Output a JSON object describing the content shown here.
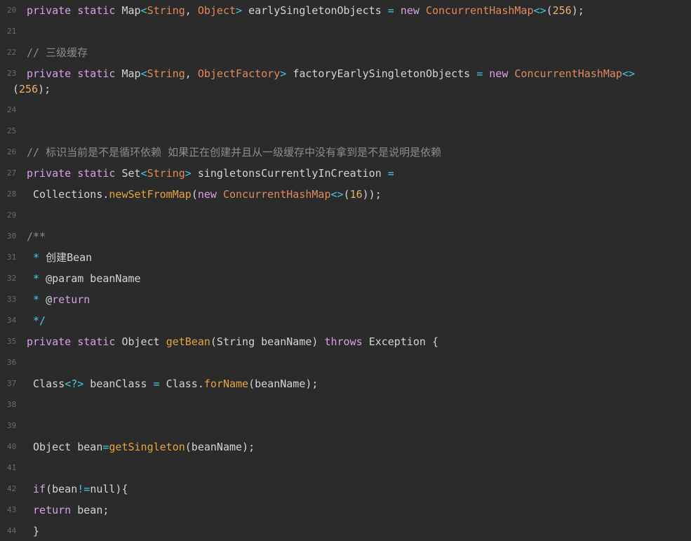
{
  "colors": {
    "background": "#2b2b2b",
    "line_number": "#6b6b6b",
    "plain": "#d4d4d4",
    "keyword": "#d7a0e6",
    "type": "#e08a5b",
    "operator": "#46c8e0",
    "function": "#e6a33e",
    "number": "#e8b26a",
    "comment": "#8c8c8c"
  },
  "lines": [
    {
      "num": "20",
      "tokens": [
        {
          "t": "private static ",
          "c": "kw"
        },
        {
          "t": "Map",
          "c": "pl"
        },
        {
          "t": "<",
          "c": "op"
        },
        {
          "t": "String",
          "c": "ty"
        },
        {
          "t": ", ",
          "c": "pl"
        },
        {
          "t": "Object",
          "c": "ty"
        },
        {
          "t": "> ",
          "c": "op"
        },
        {
          "t": "earlySingletonObjects ",
          "c": "pl"
        },
        {
          "t": "= ",
          "c": "op"
        },
        {
          "t": "new ",
          "c": "kw"
        },
        {
          "t": "ConcurrentHashMap",
          "c": "ty"
        },
        {
          "t": "<>",
          "c": "op"
        },
        {
          "t": "(",
          "c": "pl"
        },
        {
          "t": "256",
          "c": "nm"
        },
        {
          "t": ");",
          "c": "pl"
        }
      ]
    },
    {
      "num": "21",
      "tokens": []
    },
    {
      "num": "22",
      "tokens": [
        {
          "t": "// 三级缓存",
          "c": "cm"
        }
      ]
    },
    {
      "num": "23",
      "tokens": [
        {
          "t": "private static ",
          "c": "kw"
        },
        {
          "t": "Map",
          "c": "pl"
        },
        {
          "t": "<",
          "c": "op"
        },
        {
          "t": "String",
          "c": "ty"
        },
        {
          "t": ", ",
          "c": "pl"
        },
        {
          "t": "ObjectFactory",
          "c": "ty"
        },
        {
          "t": "> ",
          "c": "op"
        },
        {
          "t": "factoryEarlySingletonObjects ",
          "c": "pl"
        },
        {
          "t": "= ",
          "c": "op"
        },
        {
          "t": "new ",
          "c": "kw"
        },
        {
          "t": "ConcurrentHashMap",
          "c": "ty"
        },
        {
          "t": "<>",
          "c": "op"
        }
      ],
      "wrap": [
        {
          "t": "(",
          "c": "pl"
        },
        {
          "t": "256",
          "c": "nm"
        },
        {
          "t": ");",
          "c": "pl"
        }
      ]
    },
    {
      "num": "24",
      "tokens": []
    },
    {
      "num": "25",
      "tokens": []
    },
    {
      "num": "26",
      "tokens": [
        {
          "t": "// 标识当前是不是循环依赖 如果正在创建并且从一级缓存中没有拿到是不是说明是依赖",
          "c": "cm"
        }
      ]
    },
    {
      "num": "27",
      "tokens": [
        {
          "t": "private static ",
          "c": "kw"
        },
        {
          "t": "Set",
          "c": "pl"
        },
        {
          "t": "<",
          "c": "op"
        },
        {
          "t": "String",
          "c": "ty"
        },
        {
          "t": "> ",
          "c": "op"
        },
        {
          "t": "singletonsCurrentlyInCreation ",
          "c": "pl"
        },
        {
          "t": "=",
          "c": "op"
        }
      ]
    },
    {
      "num": "28",
      "tokens": [
        {
          "t": " Collections.",
          "c": "pl"
        },
        {
          "t": "newSetFromMap",
          "c": "fn"
        },
        {
          "t": "(",
          "c": "pl"
        },
        {
          "t": "new ",
          "c": "kw"
        },
        {
          "t": "ConcurrentHashMap",
          "c": "ty"
        },
        {
          "t": "<>",
          "c": "op"
        },
        {
          "t": "(",
          "c": "pl"
        },
        {
          "t": "16",
          "c": "nm"
        },
        {
          "t": "));",
          "c": "pl"
        }
      ]
    },
    {
      "num": "29",
      "tokens": []
    },
    {
      "num": "30",
      "tokens": [
        {
          "t": "/**",
          "c": "cm"
        }
      ]
    },
    {
      "num": "31",
      "tokens": [
        {
          "t": " * ",
          "c": "op"
        },
        {
          "t": "创建Bean",
          "c": "pl"
        }
      ]
    },
    {
      "num": "32",
      "tokens": [
        {
          "t": " * ",
          "c": "op"
        },
        {
          "t": "@param beanName",
          "c": "pl"
        }
      ]
    },
    {
      "num": "33",
      "tokens": [
        {
          "t": " * ",
          "c": "op"
        },
        {
          "t": "@",
          "c": "pl"
        },
        {
          "t": "return",
          "c": "kw"
        }
      ]
    },
    {
      "num": "34",
      "tokens": [
        {
          "t": " */",
          "c": "op"
        }
      ]
    },
    {
      "num": "35",
      "tokens": [
        {
          "t": "private static ",
          "c": "kw"
        },
        {
          "t": "Object ",
          "c": "pl"
        },
        {
          "t": "getBean",
          "c": "fn"
        },
        {
          "t": "(String beanName) ",
          "c": "pl"
        },
        {
          "t": "throws ",
          "c": "kw"
        },
        {
          "t": "Exception {",
          "c": "pl"
        }
      ]
    },
    {
      "num": "36",
      "tokens": []
    },
    {
      "num": "37",
      "tokens": [
        {
          "t": " Class",
          "c": "pl"
        },
        {
          "t": "<?>",
          "c": "op"
        },
        {
          "t": " beanClass ",
          "c": "pl"
        },
        {
          "t": "=",
          "c": "op"
        },
        {
          "t": " Class.",
          "c": "pl"
        },
        {
          "t": "forName",
          "c": "fn"
        },
        {
          "t": "(beanName);",
          "c": "pl"
        }
      ]
    },
    {
      "num": "38",
      "tokens": []
    },
    {
      "num": "39",
      "tokens": []
    },
    {
      "num": "40",
      "tokens": [
        {
          "t": " Object bean",
          "c": "pl"
        },
        {
          "t": "=",
          "c": "op"
        },
        {
          "t": "getSingleton",
          "c": "fn"
        },
        {
          "t": "(beanName);",
          "c": "pl"
        }
      ]
    },
    {
      "num": "41",
      "tokens": []
    },
    {
      "num": "42",
      "tokens": [
        {
          "t": " if",
          "c": "kw"
        },
        {
          "t": "(bean",
          "c": "pl"
        },
        {
          "t": "!=",
          "c": "op"
        },
        {
          "t": "null){",
          "c": "pl"
        }
      ]
    },
    {
      "num": "43",
      "tokens": [
        {
          "t": " return ",
          "c": "kw"
        },
        {
          "t": "bean;",
          "c": "pl"
        }
      ]
    },
    {
      "num": "44",
      "tokens": [
        {
          "t": " }",
          "c": "pl"
        }
      ]
    }
  ]
}
